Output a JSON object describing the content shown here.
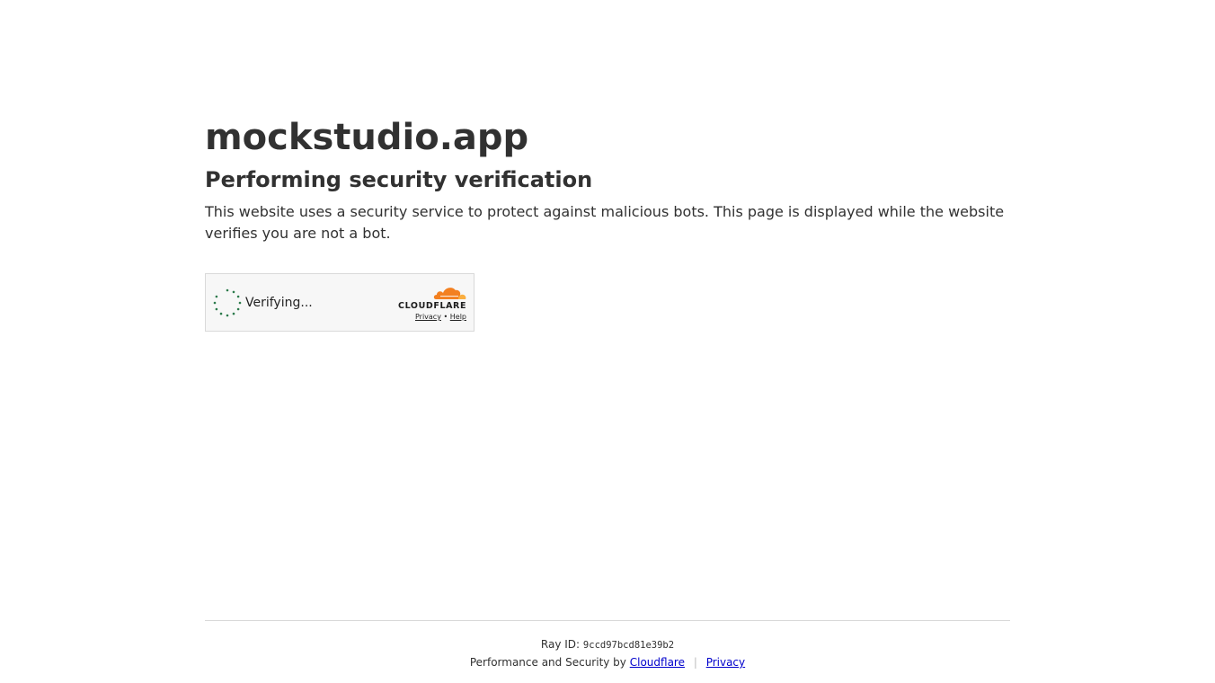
{
  "site": {
    "title": "mockstudio.app"
  },
  "verification": {
    "heading": "Performing security verification",
    "description": "This website uses a security service to protect against malicious bots. This page is displayed while the website verifies you are not a bot."
  },
  "widget": {
    "status_text": "Verifying...",
    "brand_wordmark": "CLOUDFLARE",
    "privacy_link": "Privacy",
    "link_separator": "•",
    "help_link": "Help",
    "spinner_icon": "spinner-icon",
    "cloud_icon": "cloudflare-cloud-icon",
    "colors": {
      "spinner": "#2c7a4b",
      "cloud_orange": "#f38020",
      "cloud_light": "#faae40"
    }
  },
  "footer": {
    "ray_label": "Ray ID:",
    "ray_id": "9ccd97bcd81e39b2",
    "performance_text": "Performance and Security by",
    "cloudflare_link": "Cloudflare",
    "separator": "|",
    "privacy_link": "Privacy"
  }
}
